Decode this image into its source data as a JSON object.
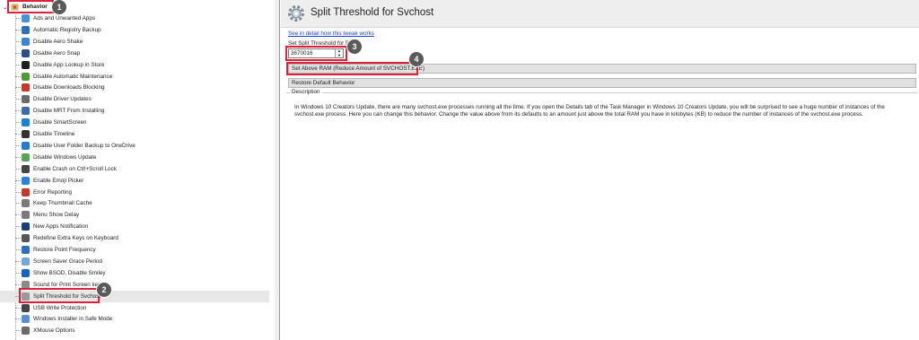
{
  "tree": {
    "root": {
      "label": "Behavior",
      "badge": "1"
    },
    "items": [
      {
        "label": "Ads and Unwanted Apps",
        "icon": "ads-icon",
        "color": "#4a8fd8"
      },
      {
        "label": "Automatic Registry Backup",
        "icon": "registry-icon",
        "color": "#2f6fb8"
      },
      {
        "label": "Disable Aero Shake",
        "icon": "window-icon",
        "color": "#3f83cf"
      },
      {
        "label": "Disable Aero Snap",
        "icon": "snap-icon",
        "color": "#2b4f84"
      },
      {
        "label": "Disable App Lookup in Store",
        "icon": "store-icon",
        "color": "#1e1e1e"
      },
      {
        "label": "Disable Automatic Maintenance",
        "icon": "maintenance-icon",
        "color": "#4f9b3a"
      },
      {
        "label": "Disable Downloads Blocking",
        "icon": "download-icon",
        "color": "#c0392b"
      },
      {
        "label": "Disable Driver Updates",
        "icon": "driver-icon",
        "color": "#6b6b6b"
      },
      {
        "label": "Disable MRT From Installing",
        "icon": "mrt-icon",
        "color": "#3b6ea8"
      },
      {
        "label": "Disable SmartScreen",
        "icon": "shield-icon",
        "color": "#1f7fd1"
      },
      {
        "label": "Disable Timeline",
        "icon": "timeline-icon",
        "color": "#333333"
      },
      {
        "label": "Disable User Folder Backup to OneDrive",
        "icon": "onedrive-icon",
        "color": "#2a7ad0"
      },
      {
        "label": "Disable Windows Update",
        "icon": "update-icon",
        "color": "#5aa35a"
      },
      {
        "label": "Enable Crash on Ctrl+Scroll Lock",
        "icon": "keyboard-icon",
        "color": "#444444"
      },
      {
        "label": "Enable Emoji Picker",
        "icon": "emoji-icon",
        "color": "#2f7fd6"
      },
      {
        "label": "Error Reporting",
        "icon": "error-icon",
        "color": "#c0392b"
      },
      {
        "label": "Keep Thumbnail Cache",
        "icon": "thumbnail-icon",
        "color": "#7a7a7a"
      },
      {
        "label": "Menu Show Delay",
        "icon": "menu-icon",
        "color": "#7a7a7a"
      },
      {
        "label": "New Apps Notification",
        "icon": "notification-icon",
        "color": "#1b3f78"
      },
      {
        "label": "Redefine Extra Keys on Keyboard",
        "icon": "keys-icon",
        "color": "#555555"
      },
      {
        "label": "Restore Point Frequency",
        "icon": "restore-icon",
        "color": "#2f6fb8"
      },
      {
        "label": "Screen Saver Grace Period",
        "icon": "screensaver-icon",
        "color": "#7aa6d6"
      },
      {
        "label": "Show BSOD, Disable Smiley",
        "icon": "bsod-icon",
        "color": "#1f5fc0"
      },
      {
        "label": "Sound for Print Screen key",
        "icon": "sound-icon",
        "color": "#8a8a8a"
      },
      {
        "label": "Split Threshold for Svchost",
        "icon": "svchost-icon",
        "color": "#9a9a9a",
        "badge": "2"
      },
      {
        "label": "USB Write Protection",
        "icon": "usb-icon",
        "color": "#444444"
      },
      {
        "label": "Windows Installer in Safe Mode",
        "icon": "installer-icon",
        "color": "#5a8fcf"
      },
      {
        "label": "XMouse Options",
        "icon": "mouse-icon",
        "color": "#6a6a6a"
      }
    ]
  },
  "panel": {
    "title": "Split Threshold for Svchost",
    "header_icon": "gear-icon",
    "link": "See in detail how this tweak works",
    "field_label": "Set Split Threshold for S",
    "field_badge": "3",
    "value": "3670016",
    "set_button": "Set Above RAM (Reduce Amount of SVCHOST.EXE)",
    "set_badge": "4",
    "restore_button": "Restore Default Behavior",
    "description_caption": "Description",
    "description": "In Windows 10 Creators Update, there are many svchost.exe processes running all the time. If you open the Details tab of the Task Manager in Windows 10 Creators Update, you will be surprised to see a huge number of instances of the svchost.exe process. Here you can change this behavior. Change the value above from its defaults to an amount just above the total RAM you have in kilobytes (KB) to reduce the number of instances of the svchost.exe process."
  },
  "colors": {
    "highlight": "#d9233c",
    "badge": "#5a5a5a",
    "link": "#1a3fd6"
  }
}
